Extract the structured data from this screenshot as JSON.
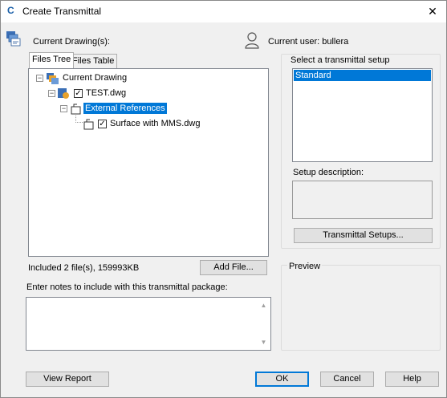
{
  "window": {
    "title": "Create Transmittal",
    "close_glyph": "✕",
    "app_icon_glyph": "C"
  },
  "header": {
    "current_drawings_label": "Current Drawing(s):",
    "current_user_label": "Current user: bullera"
  },
  "tabs": [
    {
      "label": "Files Tree",
      "active": true
    },
    {
      "label": "Files Table",
      "active": false
    }
  ],
  "tree": [
    {
      "label": "Current Drawing",
      "icon": "drawing-set-icon",
      "checked": null,
      "expanded": true,
      "selected": false
    },
    {
      "label": "TEST.dwg",
      "icon": "dwg-file-icon",
      "checked": true,
      "expanded": true,
      "selected": false
    },
    {
      "label": "External References",
      "icon": "xref-icon",
      "checked": null,
      "expanded": true,
      "selected": true
    },
    {
      "label": "Surface with MMS.dwg",
      "icon": "xref-file-icon",
      "checked": true,
      "expanded": null,
      "selected": false
    }
  ],
  "status": {
    "included_text": "Included 2 file(s), 159993KB"
  },
  "buttons": {
    "add_file": "Add  File...",
    "transmittal_setups": "Transmittal Setups...",
    "view_report": "View Report",
    "ok": "OK",
    "cancel": "Cancel",
    "help": "Help"
  },
  "notes": {
    "label": "Enter notes to include with this transmittal package:",
    "value": ""
  },
  "setup": {
    "label": "Select a transmittal setup",
    "options": [
      "Standard"
    ],
    "selected": "Standard",
    "description_label": "Setup description:",
    "description_value": ""
  },
  "preview": {
    "label": "Preview"
  },
  "colors": {
    "selection": "#0078d7",
    "dialog_bg": "#f0f0f0"
  }
}
